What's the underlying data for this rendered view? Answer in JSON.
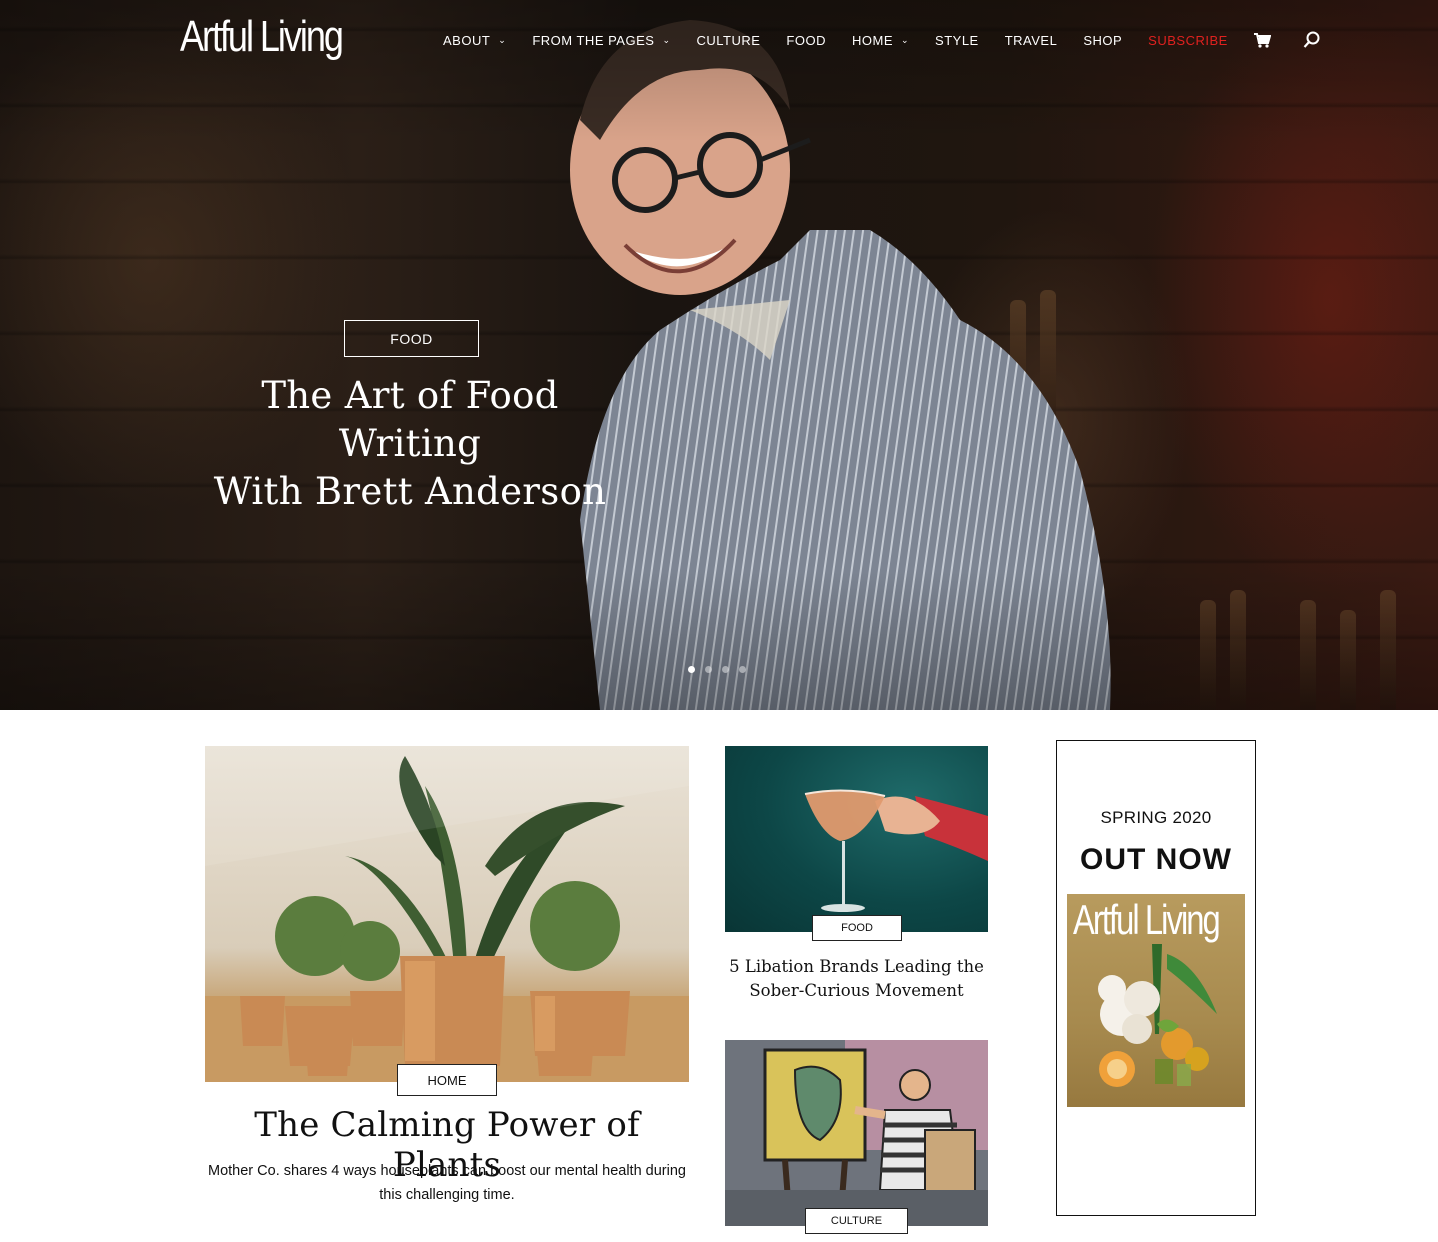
{
  "site": {
    "logo": "Artful Living"
  },
  "nav": {
    "items": [
      {
        "label": "ABOUT",
        "dropdown": true
      },
      {
        "label": "FROM THE PAGES",
        "dropdown": true
      },
      {
        "label": "CULTURE",
        "dropdown": false
      },
      {
        "label": "FOOD",
        "dropdown": false
      },
      {
        "label": "HOME",
        "dropdown": true
      },
      {
        "label": "STYLE",
        "dropdown": false
      },
      {
        "label": "TRAVEL",
        "dropdown": false
      },
      {
        "label": "SHOP",
        "dropdown": false
      }
    ],
    "subscribe": "SUBSCRIBE",
    "cart_icon": "cart-icon",
    "search_icon": "search-icon",
    "subscribe_color": "#e0211f"
  },
  "hero": {
    "tag": "FOOD",
    "title_line1": "The Art of Food Writing",
    "title_line2": "With Brett Anderson",
    "slides_total": 4,
    "active_slide": 1
  },
  "feature": {
    "tag": "HOME",
    "title": "The Calming Power of Plants",
    "description": "Mother Co. shares 4 ways houseplants can boost our mental health during this challenging time."
  },
  "cards": [
    {
      "tag": "FOOD",
      "title_line1": "5 Libation Brands Leading the",
      "title_line2": "Sober-Curious Movement"
    },
    {
      "tag": "CULTURE",
      "title_line1": "",
      "title_line2": ""
    }
  ],
  "ad": {
    "line1": "SPRING 2020",
    "line2": "OUT NOW",
    "cover_logo": "Artful Living"
  }
}
